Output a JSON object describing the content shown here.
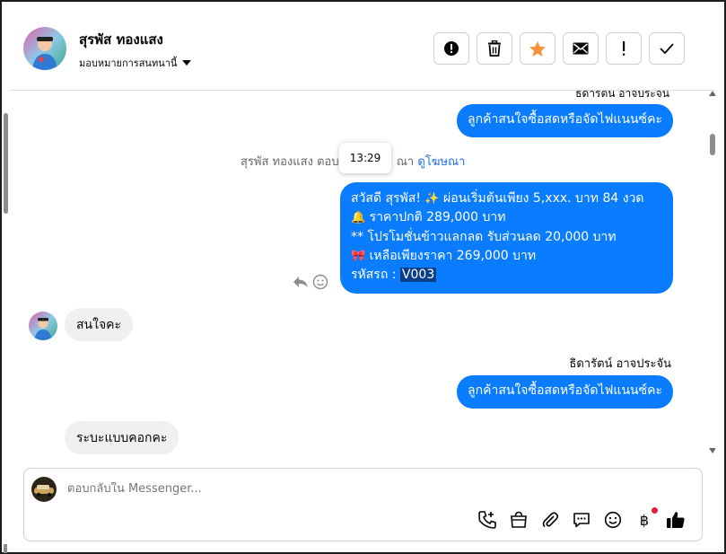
{
  "header": {
    "contact_name": "สุรพัส ทองแสง",
    "assign_label": "มอบหมายการสนทนานี้",
    "actions": [
      "report",
      "delete",
      "star",
      "mark-unread",
      "follow-up",
      "done"
    ]
  },
  "conversation": {
    "top_sender": "ธิดารัตน์ อาจประจัน",
    "msg_out_1": "ลูกค้าสนใจซื้อสดหรือจัดไฟแนนซ์คะ",
    "meta_prefix": "สุรพัส ทองแสง ตอบ",
    "meta_suffix": "ณา",
    "meta_link": "ดูโฆษณา",
    "tooltip_time": "13:29",
    "ad_line_1_a": "สวัสดี สุรพัส!",
    "ad_line_1_b": "ผ่อนเริ่มต้นเพียง 5,xxx. บาท 84 งวด",
    "ad_line_2": "ราคาปกติ 289,000 บาท",
    "ad_line_3": "** โปรโมชั่นข้าวแลกลด รับส่วนลด 20,000 บาท",
    "ad_line_4": "เหลือเพียงราคา 269,000 บาท",
    "ad_line_5_label": "รหัสรถ :",
    "ad_line_5_code": "V003",
    "msg_in_1": "สนใจคะ",
    "mid_sender": "ธิดารัตน์ อาจประจัน",
    "msg_out_2": "ลูกค้าสนใจซื้อสดหรือจัดไฟแนนซ์คะ",
    "msg_in_2": "ระบะแบบคอกคะ"
  },
  "composer": {
    "placeholder": "ตอบกลับใน Messenger...",
    "baht_symbol": "฿"
  },
  "colors": {
    "outgoing_bubble": "#0a7cff",
    "incoming_bubble": "#f0f0f0",
    "star": "#f7923a",
    "link": "#216fdb"
  }
}
